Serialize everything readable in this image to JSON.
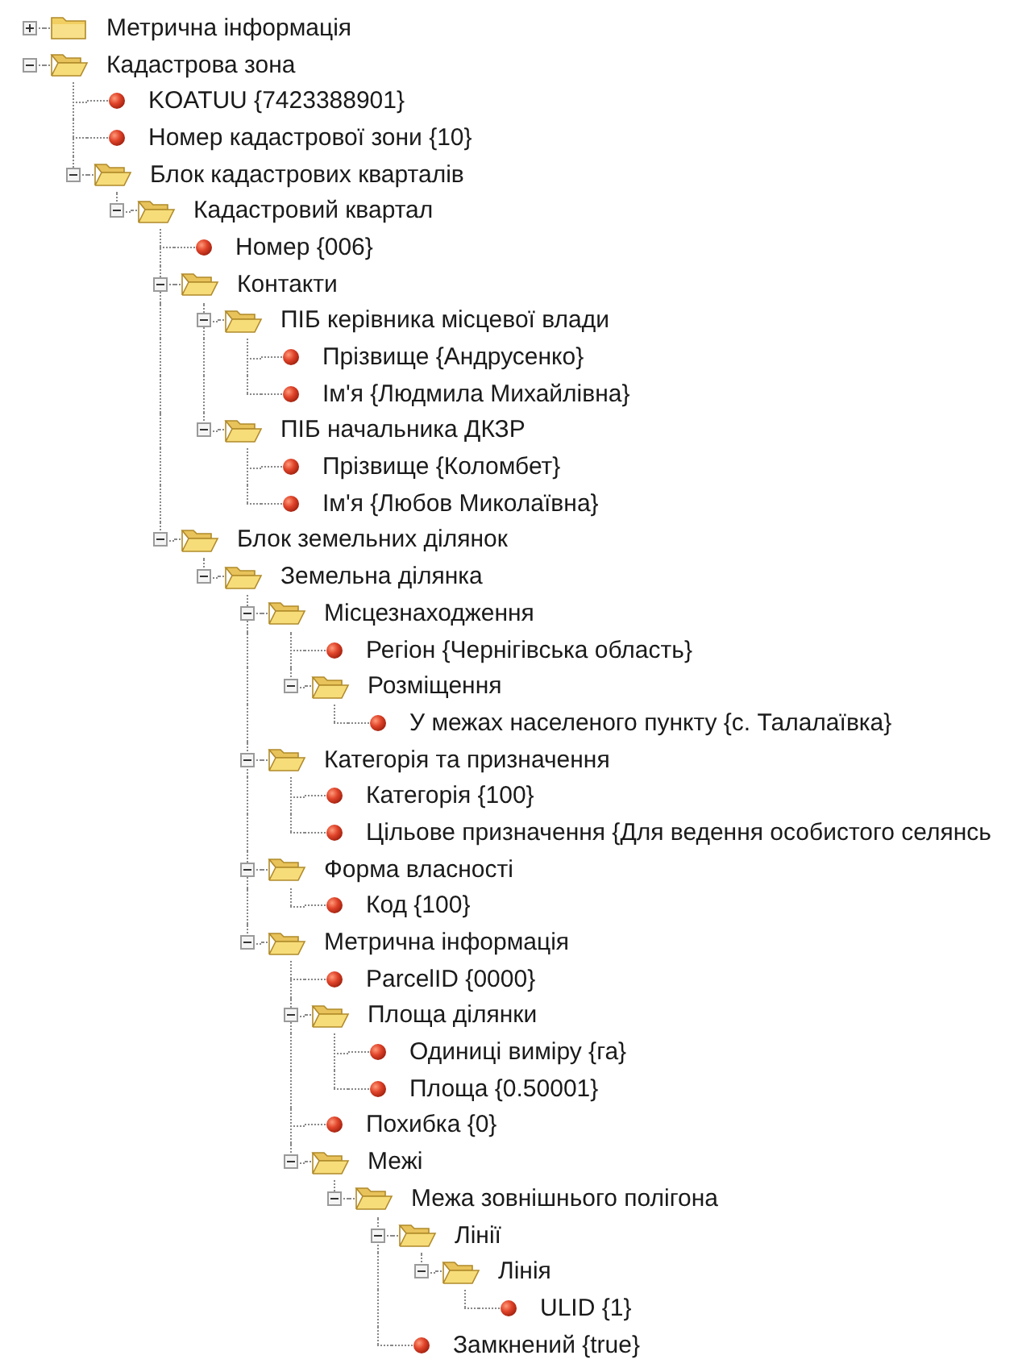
{
  "tree": [
    {
      "kind": "folder",
      "label": "Метрична інформація",
      "expanded": false
    },
    {
      "kind": "folder",
      "label": "Кадастрова зона",
      "expanded": true,
      "children": [
        {
          "kind": "leaf",
          "label": "KOATUU {7423388901}"
        },
        {
          "kind": "leaf",
          "label": "Номер кадастрової зони {10}"
        },
        {
          "kind": "folder",
          "label": "Блок кадастрових кварталів",
          "expanded": true,
          "children": [
            {
              "kind": "folder",
              "label": "Кадастровий квартал",
              "expanded": true,
              "children": [
                {
                  "kind": "leaf",
                  "label": "Номер {006}"
                },
                {
                  "kind": "folder",
                  "label": "Контакти",
                  "expanded": true,
                  "children": [
                    {
                      "kind": "folder",
                      "label": "ПІБ керівника місцевої влади",
                      "expanded": true,
                      "children": [
                        {
                          "kind": "leaf",
                          "label": "Прізвище {Андрусенко}"
                        },
                        {
                          "kind": "leaf",
                          "label": "Ім'я {Людмила Михайлівна}"
                        }
                      ]
                    },
                    {
                      "kind": "folder",
                      "label": "ПІБ начальника ДКЗР",
                      "expanded": true,
                      "children": [
                        {
                          "kind": "leaf",
                          "label": "Прізвище {Коломбет}"
                        },
                        {
                          "kind": "leaf",
                          "label": "Ім'я {Любов Миколаївна}"
                        }
                      ]
                    }
                  ]
                },
                {
                  "kind": "folder",
                  "label": "Блок земельних ділянок",
                  "expanded": true,
                  "children": [
                    {
                      "kind": "folder",
                      "label": "Земельна ділянка",
                      "expanded": true,
                      "children": [
                        {
                          "kind": "folder",
                          "label": "Місцезнаходження",
                          "expanded": true,
                          "children": [
                            {
                              "kind": "leaf",
                              "label": "Регіон {Чернігівська область}"
                            },
                            {
                              "kind": "folder",
                              "label": "Розміщення",
                              "expanded": true,
                              "children": [
                                {
                                  "kind": "leaf",
                                  "label": "У межах населеного пункту {с. Талалаївка}"
                                }
                              ]
                            }
                          ]
                        },
                        {
                          "kind": "folder",
                          "label": "Категорія та призначення",
                          "expanded": true,
                          "children": [
                            {
                              "kind": "leaf",
                              "label": "Категорія {100}"
                            },
                            {
                              "kind": "leaf",
                              "label": "Цільове призначення {Для ведення особистого селянсь"
                            }
                          ]
                        },
                        {
                          "kind": "folder",
                          "label": "Форма власності",
                          "expanded": true,
                          "children": [
                            {
                              "kind": "leaf",
                              "label": "Код {100}"
                            }
                          ]
                        },
                        {
                          "kind": "folder",
                          "label": "Метрична інформація",
                          "expanded": true,
                          "children": [
                            {
                              "kind": "leaf",
                              "label": "ParcelID {0000}"
                            },
                            {
                              "kind": "folder",
                              "label": "Площа ділянки",
                              "expanded": true,
                              "children": [
                                {
                                  "kind": "leaf",
                                  "label": "Одиниці виміру {га}"
                                },
                                {
                                  "kind": "leaf",
                                  "label": "Площа {0.50001}"
                                }
                              ]
                            },
                            {
                              "kind": "leaf",
                              "label": "Похибка {0}"
                            },
                            {
                              "kind": "folder",
                              "label": "Межі",
                              "expanded": true,
                              "children": [
                                {
                                  "kind": "folder",
                                  "label": "Межа зовнішнього полігона",
                                  "expanded": true,
                                  "children": [
                                    {
                                      "kind": "folder",
                                      "label": "Лінії",
                                      "expanded": true,
                                      "children": [
                                        {
                                          "kind": "folder",
                                          "label": "Лінія",
                                          "expanded": true,
                                          "children": [
                                            {
                                              "kind": "leaf",
                                              "label": "ULID {1}"
                                            }
                                          ]
                                        }
                                      ]
                                    },
                                    {
                                      "kind": "leaf",
                                      "label": "Замкнений {true}"
                                    }
                                  ]
                                }
                              ]
                            }
                          ]
                        }
                      ]
                    }
                  ]
                }
              ]
            }
          ]
        }
      ]
    }
  ]
}
